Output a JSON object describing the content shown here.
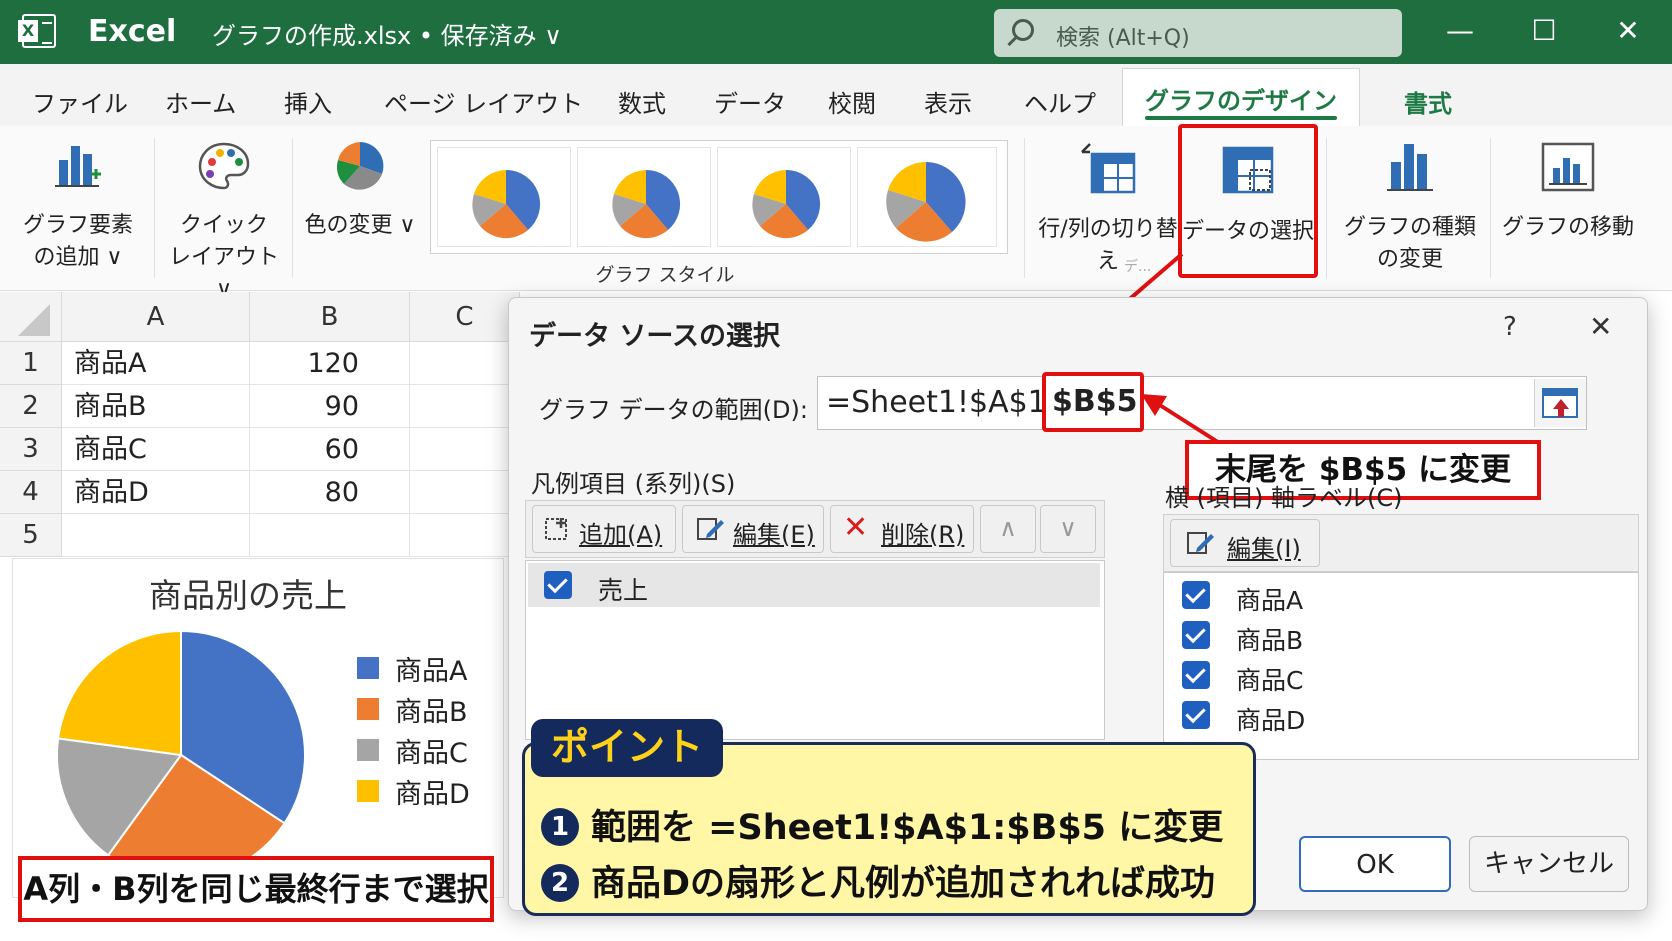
{
  "titlebar": {
    "app": "Excel",
    "document": "グラフの作成.xlsx • 保存済み ∨",
    "search_placeholder": "検索 (Alt+Q)",
    "minimize": "—",
    "maximize": "☐",
    "close": "✕"
  },
  "menu": {
    "tabs": [
      "ファイル",
      "ホーム",
      "挿入",
      "ページ レイアウト",
      "数式",
      "データ",
      "校閲",
      "表示",
      "ヘルプ",
      "グラフのデザイン",
      "書式"
    ],
    "active": "グラフのデザイン"
  },
  "ribbon": {
    "add_element": [
      "グラフ要素",
      "の追加 ∨"
    ],
    "quick_layout": [
      "クイック",
      "レイアウト ∨"
    ],
    "change_color": "色の変更 ∨",
    "styles_group_label": "グラフ スタイル",
    "switch_rowcol": "行/列の切り替え",
    "select_data": "データの選択",
    "change_type": [
      "グラフの種類",
      "の変更"
    ],
    "move_chart": "グラフの移動",
    "data_group_label": "デ..."
  },
  "sheet": {
    "columns": [
      "A",
      "B",
      "C"
    ],
    "rows": [
      {
        "n": "1",
        "a": "商品A",
        "b": "120"
      },
      {
        "n": "2",
        "a": "商品B",
        "b": "90"
      },
      {
        "n": "3",
        "a": "商品C",
        "b": "60"
      },
      {
        "n": "4",
        "a": "商品D",
        "b": "80"
      },
      {
        "n": "5",
        "a": "",
        "b": ""
      }
    ]
  },
  "chart_data": {
    "type": "pie",
    "title": "商品別の売上",
    "categories": [
      "商品A",
      "商品B",
      "商品C",
      "商品D"
    ],
    "values": [
      120,
      90,
      60,
      80
    ],
    "colors": [
      "#4472c4",
      "#ed7d31",
      "#a5a5a5",
      "#ffc000"
    ],
    "legend": "right"
  },
  "sheet_callout": "A列・B列を同じ最終行まで選択",
  "dialog": {
    "title": "データ ソースの選択",
    "help": "?",
    "close": "✕",
    "range_label": "グラフ データの範囲(D):",
    "range_prefix": "=Sheet1!$A$1:",
    "range_highlight": "$B$5",
    "range_callout": "末尾を $B$5 に変更",
    "series_label": "凡例項目 (系列)(S)",
    "add_btn": "追加(A)",
    "edit_btn": "編集(E)",
    "delete_btn": "削除(R)",
    "up_btn": "∧",
    "down_btn": "∨",
    "series": [
      "売上"
    ],
    "axis_label": "横 (項目) 軸ラベル(C)",
    "axis_edit_btn": "編集(I)",
    "axis_items": [
      "商品A",
      "商品B",
      "商品C",
      "商品D"
    ],
    "ok": "OK",
    "cancel": "キャンセル"
  },
  "point": {
    "tag": "ポイント",
    "items": [
      {
        "num": "1",
        "text": "範囲を =Sheet1!$A$1:$B$5 に変更"
      },
      {
        "num": "2",
        "text": "商品Dの扇形と凡例が追加されれば成功"
      }
    ]
  },
  "colors": {
    "excel_green": "#1f6e3f",
    "accent_red": "#e01010",
    "point_bg": "#fff7a6",
    "point_navy": "#142a5c"
  }
}
